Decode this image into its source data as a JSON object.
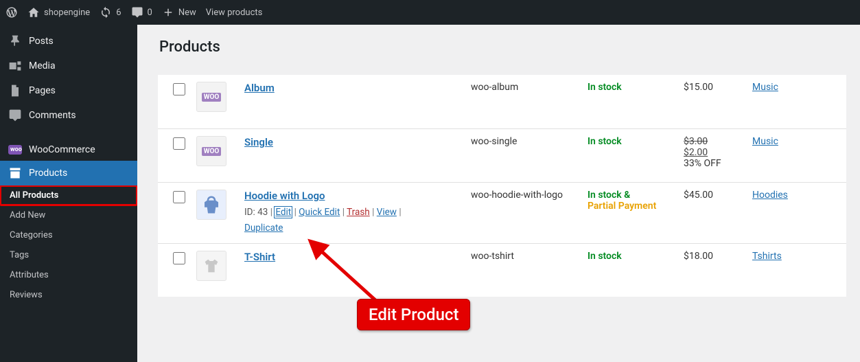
{
  "topbar": {
    "site_name": "shopengine",
    "updates_count": "6",
    "comments_count": "0",
    "new_label": "New",
    "view_label": "View products"
  },
  "sidebar": {
    "posts": "Posts",
    "media": "Media",
    "pages": "Pages",
    "comments": "Comments",
    "woocommerce": "WooCommerce",
    "products": "Products",
    "submenu": {
      "all": "All Products",
      "add": "Add New",
      "categories": "Categories",
      "tags": "Tags",
      "attributes": "Attributes",
      "reviews": "Reviews"
    }
  },
  "page": {
    "title": "Products"
  },
  "rows": [
    {
      "name": "Album",
      "sku": "woo-album",
      "stock": "In stock",
      "price": "$15.00",
      "category": "Music"
    },
    {
      "name": "Single",
      "sku": "woo-single",
      "stock": "In stock",
      "price_old": "$3.00",
      "price_new": "$2.00",
      "discount": "33% OFF",
      "category": "Music"
    },
    {
      "name": "Hoodie with Logo",
      "id_label": "ID: 43",
      "actions": {
        "edit": "Edit",
        "quick": "Quick Edit",
        "trash": "Trash",
        "view": "View",
        "dup": "Duplicate"
      },
      "sku": "woo-hoodie-with-logo",
      "stock": "In stock &",
      "stock2": "Partial Payment",
      "price": "$45.00",
      "category": "Hoodies"
    },
    {
      "name": "T-Shirt",
      "sku": "woo-tshirt",
      "stock": "In stock",
      "price": "$18.00",
      "category": "Tshirts"
    }
  ],
  "annotation": {
    "label": "Edit Product"
  }
}
